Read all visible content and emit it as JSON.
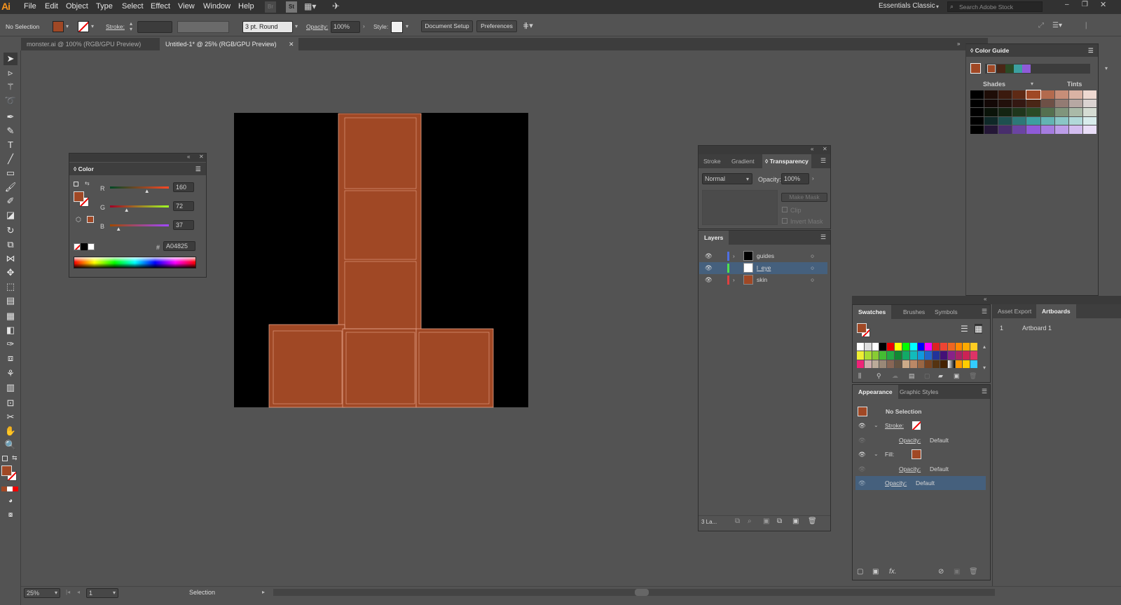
{
  "menu": {
    "logo": "Ai",
    "items": [
      "File",
      "Edit",
      "Object",
      "Type",
      "Select",
      "Effect",
      "View",
      "Window",
      "Help"
    ],
    "bridge": "Br",
    "stock": "St",
    "workspace": "Essentials Classic",
    "search_placeholder": "Search Adobe Stock"
  },
  "control": {
    "selection": "No Selection",
    "stroke_label": "Stroke:",
    "brush": "3 pt. Round",
    "opacity_label": "Opacity:",
    "opacity": "100%",
    "style_label": "Style:",
    "doc_setup": "Document Setup",
    "preferences": "Preferences"
  },
  "tabs": [
    {
      "label": "monster.ai @ 100% (RGB/GPU Preview)"
    },
    {
      "label": "Untitled-1* @ 25% (RGB/GPU Preview)"
    }
  ],
  "color_panel": {
    "title": "Color",
    "r_label": "R",
    "r": "160",
    "r_value": 160,
    "g_label": "G",
    "g": "72",
    "g_value": 72,
    "b_label": "B",
    "b": "37",
    "b_value": 37,
    "hash": "#",
    "hex": "A04825",
    "fill": "#A04825"
  },
  "transparency": {
    "tabs": [
      "Stroke",
      "Gradient",
      "Transparency"
    ],
    "blend": "Normal",
    "opacity_label": "Opacity:",
    "opacity": "100%",
    "make_mask": "Make Mask",
    "clip": "Clip",
    "invert": "Invert Mask"
  },
  "layers": {
    "title": "Layers",
    "items": [
      {
        "name": "guides",
        "color": "#4f6fe0"
      },
      {
        "name": "l_eye",
        "color": "#4ee04e"
      },
      {
        "name": "skin",
        "color": "#e04040"
      }
    ],
    "count": "3 La..."
  },
  "color_guide": {
    "title": "Color Guide",
    "shades": "Shades",
    "tints": "Tints"
  },
  "swatches": {
    "tabs": [
      "Swatches",
      "Brushes",
      "Symbols"
    ]
  },
  "artboards": {
    "tabs": [
      "Asset Export",
      "Artboards"
    ],
    "items": [
      {
        "num": "1",
        "name": "Artboard 1"
      }
    ]
  },
  "appearance": {
    "tabs": [
      "Appearance",
      "Graphic Styles"
    ],
    "title": "No Selection",
    "stroke": "Stroke:",
    "fill": "Fill:",
    "opacity_label": "Opacity:",
    "default": "Default"
  },
  "status": {
    "zoom": "25%",
    "page": "1",
    "tool": "Selection"
  }
}
